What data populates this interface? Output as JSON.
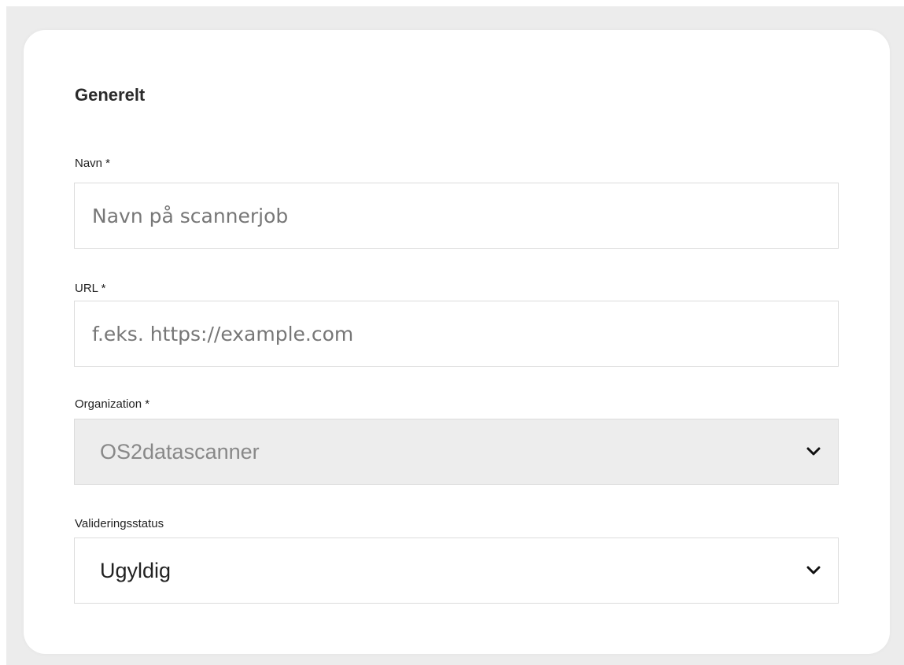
{
  "section": {
    "title": "Generelt"
  },
  "fields": {
    "name": {
      "label": "Navn *",
      "placeholder": "Navn på scannerjob",
      "value": ""
    },
    "url": {
      "label": "URL *",
      "placeholder": "f.eks. https://example.com",
      "value": ""
    },
    "organization": {
      "label": "Organization *",
      "selected": "OS2datascanner",
      "disabled": true,
      "icon": "chevron-down-icon"
    },
    "validation_status": {
      "label": "Valideringsstatus",
      "selected": "Ugyldig",
      "icon": "chevron-down-icon"
    }
  },
  "colors": {
    "card_background": "#ffffff",
    "page_background": "#ececec",
    "field_border": "#dcdcdc",
    "disabled_field": "#ededed"
  }
}
